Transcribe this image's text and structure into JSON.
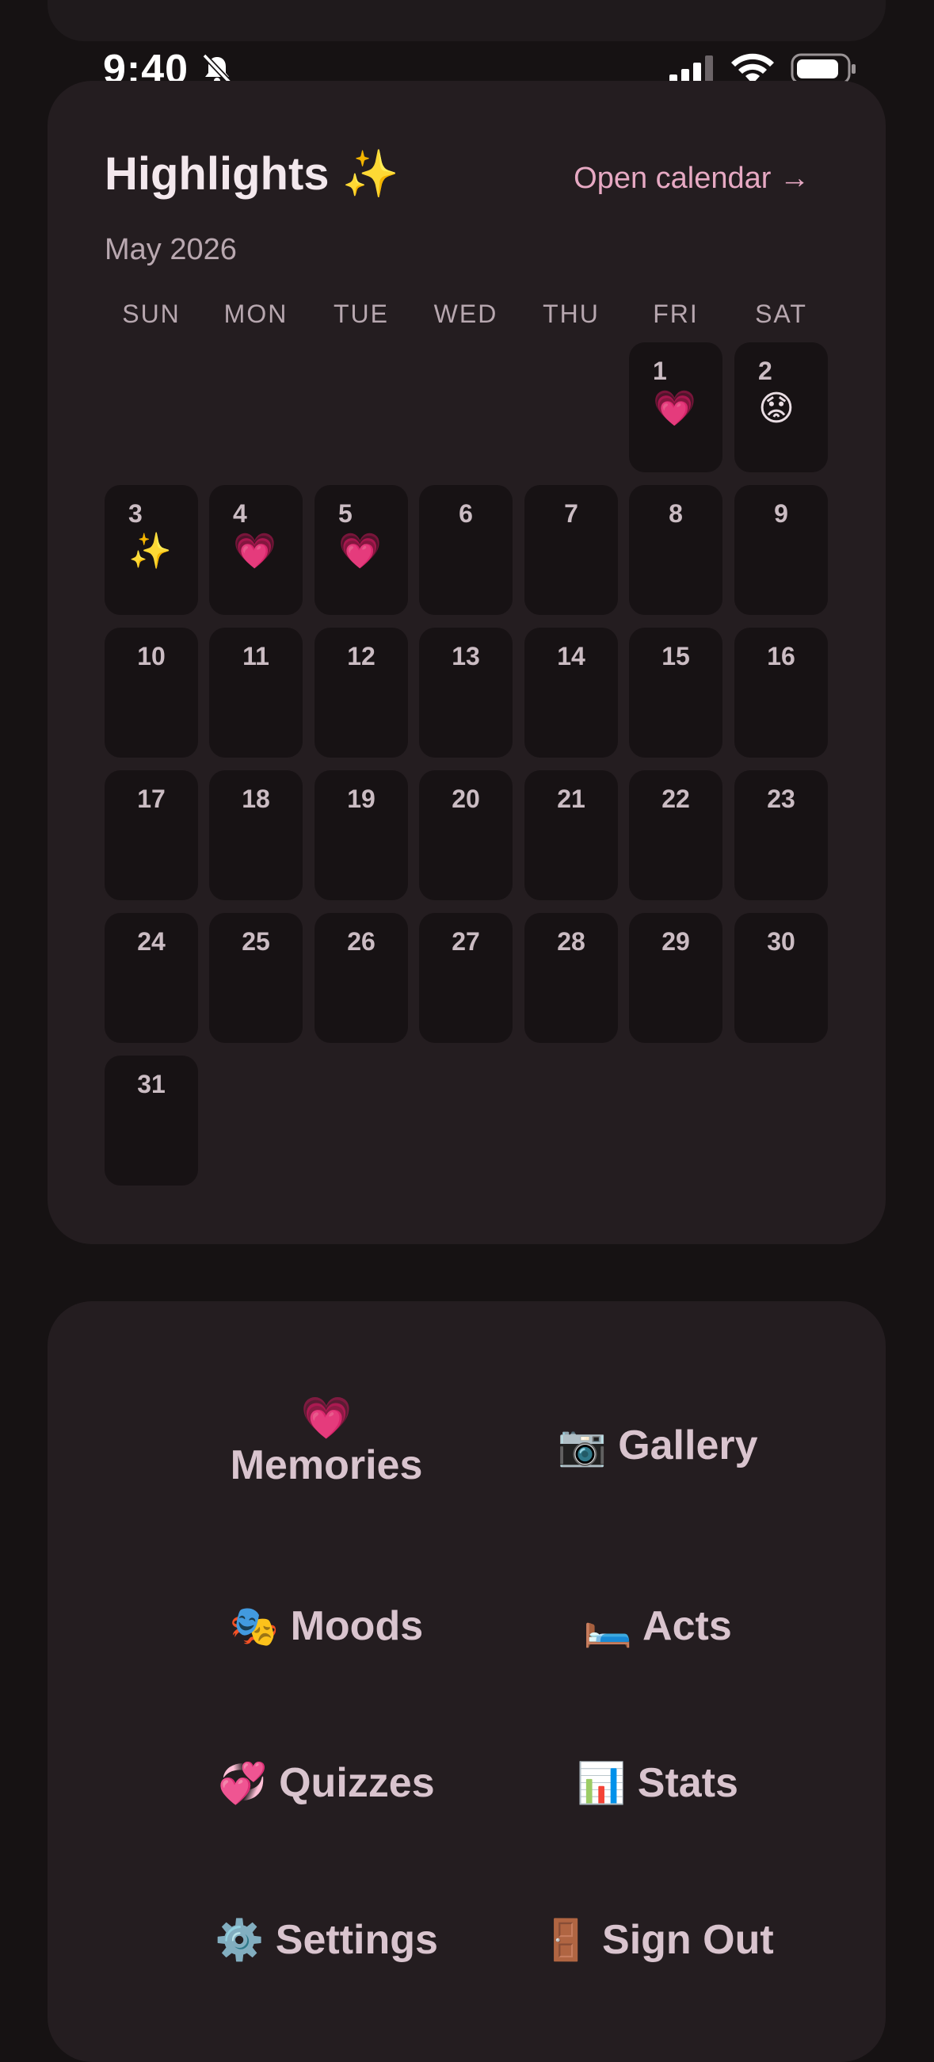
{
  "status": {
    "time": "9:40"
  },
  "calendar": {
    "title": "Highlights ✨",
    "link": "Open calendar →",
    "month": "May 2026",
    "weekdays": [
      "SUN",
      "MON",
      "TUE",
      "WED",
      "THU",
      "FRI",
      "SAT"
    ],
    "days": [
      {
        "n": "1",
        "e": "💗"
      },
      {
        "n": "2",
        "e": "😟"
      },
      {
        "n": "3",
        "e": "✨"
      },
      {
        "n": "4",
        "e": "💗"
      },
      {
        "n": "5",
        "e": "💗"
      },
      {
        "n": "6"
      },
      {
        "n": "7"
      },
      {
        "n": "8"
      },
      {
        "n": "9"
      },
      {
        "n": "10"
      },
      {
        "n": "11"
      },
      {
        "n": "12"
      },
      {
        "n": "13"
      },
      {
        "n": "14"
      },
      {
        "n": "15"
      },
      {
        "n": "16"
      },
      {
        "n": "17"
      },
      {
        "n": "18"
      },
      {
        "n": "19"
      },
      {
        "n": "20"
      },
      {
        "n": "21"
      },
      {
        "n": "22"
      },
      {
        "n": "23"
      },
      {
        "n": "24"
      },
      {
        "n": "25"
      },
      {
        "n": "26"
      },
      {
        "n": "27"
      },
      {
        "n": "28"
      },
      {
        "n": "29"
      },
      {
        "n": "30"
      },
      {
        "n": "31"
      }
    ]
  },
  "nav": {
    "memories": {
      "icon": "💗",
      "label": "Memories"
    },
    "gallery": {
      "icon": "📷",
      "label": "Gallery"
    },
    "moods": {
      "icon": "🎭",
      "label": "Moods"
    },
    "acts": {
      "icon": "🛏️",
      "label": "Acts"
    },
    "quizzes": {
      "icon": "💞",
      "label": "Quizzes"
    },
    "stats": {
      "icon": "📊",
      "label": "Stats"
    },
    "settings": {
      "icon": "⚙️",
      "label": "Settings"
    },
    "signout": {
      "icon": "🚪",
      "label": "Sign Out"
    }
  }
}
